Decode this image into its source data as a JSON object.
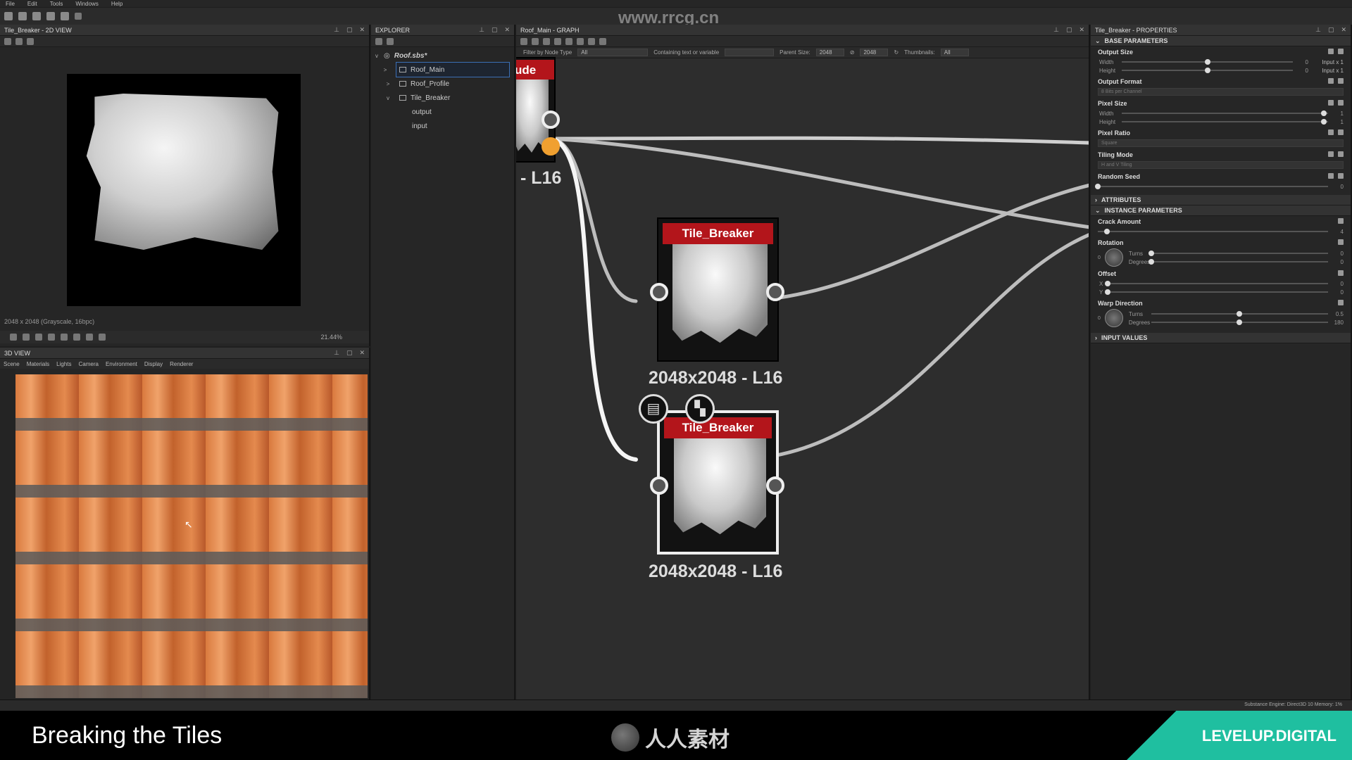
{
  "menu": [
    "File",
    "Edit",
    "Tools",
    "Windows",
    "Help"
  ],
  "watermark": "www.rrcg.cn",
  "view2d": {
    "title": "Tile_Breaker - 2D VIEW",
    "info": "2048 x 2048 (Grayscale, 16bpc)",
    "zoom": "21.44%"
  },
  "view3d": {
    "title": "3D VIEW",
    "menu": [
      "Scene",
      "Materials",
      "Lights",
      "Camera",
      "Environment",
      "Display",
      "Renderer"
    ]
  },
  "explorer": {
    "title": "EXPLORER",
    "items": [
      {
        "label": "Roof.sbs*",
        "level": 0,
        "chevron": "v"
      },
      {
        "label": "Roof_Main",
        "level": 1,
        "chevron": ">"
      },
      {
        "label": "Roof_Profile",
        "level": 1,
        "chevron": ">"
      },
      {
        "label": "Tile_Breaker",
        "level": 1,
        "chevron": "v"
      },
      {
        "label": "output",
        "level": 2,
        "chevron": ""
      },
      {
        "label": "input",
        "level": 2,
        "chevron": ""
      }
    ]
  },
  "graph": {
    "title": "Roof_Main - GRAPH",
    "filter_label": "Filter by Node Type",
    "filter_value": "All",
    "containing_label": "Containing text or variable",
    "parent_size_label": "Parent Size:",
    "parent_size_value": "2048",
    "size_value2": "2048",
    "thumbnails_label": "Thumbnails:",
    "thumbnails_value": "All",
    "partial_node_title": "ude",
    "partial_node_label": "- L16",
    "nodes": [
      {
        "title": "Tile_Breaker",
        "label": "2048x2048 - L16"
      },
      {
        "title": "Tile_Breaker",
        "label": "2048x2048 - L16"
      }
    ]
  },
  "props": {
    "title": "Tile_Breaker - PROPERTIES",
    "base_section": "BASE PARAMETERS",
    "output_size": {
      "label": "Output Size",
      "width_label": "Width",
      "width_val": "0",
      "width_extra": "Input x 1",
      "height_label": "Height",
      "height_val": "0",
      "height_extra": "Input x 1",
      "width_level": 0.5,
      "height_level": 0.5
    },
    "output_format": {
      "label": "Output Format",
      "value": "8 Bits per Channel"
    },
    "pixel_size": {
      "label": "Pixel Size",
      "width_label": "Width",
      "width_val": "1",
      "height_label": "Height",
      "height_val": "1",
      "level": 0.98
    },
    "pixel_ratio": {
      "label": "Pixel Ratio",
      "value": "Square"
    },
    "tiling_mode": {
      "label": "Tiling Mode",
      "value": "H and V Tiling"
    },
    "random_seed": {
      "label": "Random Seed",
      "value": "0",
      "level": 0.0
    },
    "attributes_section": "ATTRIBUTES",
    "instance_section": "INSTANCE PARAMETERS",
    "crack_amount": {
      "label": "Crack Amount",
      "value": "4",
      "level": 0.04
    },
    "rotation": {
      "label": "Rotation",
      "turns_label": "Turns",
      "turns_val": "0",
      "degrees_label": "Degrees",
      "degrees_val": "0",
      "dial_val": "0"
    },
    "offset": {
      "label": "Offset",
      "x_label": "X",
      "x_val": "0",
      "y_label": "Y",
      "y_val": "0"
    },
    "warp_direction": {
      "label": "Warp Direction",
      "turns_label": "Turns",
      "turns_val": "0.5",
      "degrees_label": "Degrees",
      "degrees_val": "180",
      "dial_val": "0",
      "level": 0.5
    },
    "input_values_section": "INPUT VALUES"
  },
  "status": {
    "engine": "Substance Engine: Direct3D 10  Memory: 1%"
  },
  "footer": {
    "title": "Breaking the Tiles",
    "center": "人人素材",
    "brand": "LEVELUP.DIGITAL"
  },
  "colors": {
    "node_header": "#b3151b",
    "accent_teal": "#1fbfa0",
    "port_orange": "#f0a030",
    "selection": "#3b6fb5"
  }
}
